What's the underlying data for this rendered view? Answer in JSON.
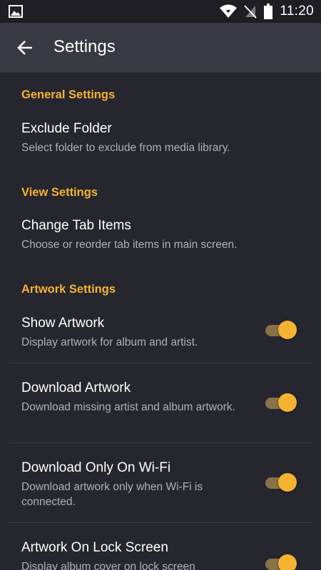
{
  "status_bar": {
    "time": "11:20",
    "icons": [
      "image-notification-icon",
      "wifi-icon",
      "no-signal-icon",
      "battery-icon"
    ]
  },
  "app_bar": {
    "title": "Settings",
    "back_icon": "arrow-back-icon"
  },
  "colors": {
    "accent": "#f5b331",
    "background": "#26262e",
    "app_bar": "#393944",
    "status_bar": "#1e1e24",
    "summary_text": "#b0b0b8"
  },
  "sections": [
    {
      "header": "General Settings",
      "items": [
        {
          "title": "Exclude Folder",
          "summary": "Select folder to exclude from media library."
        }
      ]
    },
    {
      "header": "View Settings",
      "items": [
        {
          "title": "Change Tab Items",
          "summary": "Choose or reorder tab items in main screen."
        }
      ]
    },
    {
      "header": "Artwork Settings",
      "items": [
        {
          "title": "Show Artwork",
          "summary": "Display artwork for album and artist.",
          "toggle": true
        },
        {
          "title": "Download Artwork",
          "summary": "Download missing artist and album artwork.",
          "toggle": true
        },
        {
          "title": "Download Only On Wi-Fi",
          "summary": "Download artwork only when Wi-Fi is connected.",
          "toggle": true
        },
        {
          "title": "Artwork On Lock Screen",
          "summary": "Display album cover on lock screen",
          "toggle": true
        }
      ]
    }
  ]
}
